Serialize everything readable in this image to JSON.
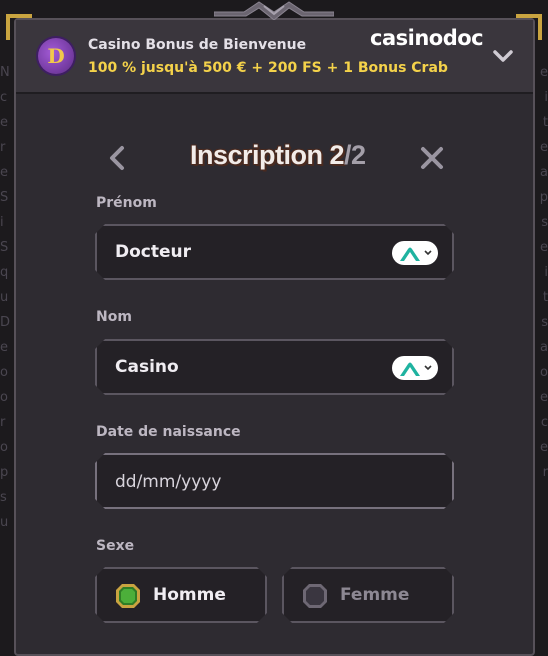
{
  "promo": {
    "title": "Casino Bonus de Bienvenue",
    "offer": "100 % jusqu'à 500 € + 200 FS + 1 Bonus Crab",
    "brand": "casinodoc",
    "logo_letter": "D"
  },
  "form": {
    "title_prefix": "Inscription 2",
    "title_suffix": "/2",
    "fields": {
      "first_name": {
        "label": "Prénom",
        "value": "Docteur"
      },
      "last_name": {
        "label": "Nom",
        "value": "Casino"
      },
      "birthdate": {
        "label": "Date de naissance",
        "placeholder": "dd/mm/yyyy"
      }
    },
    "gender": {
      "label": "Sexe",
      "options": [
        "Homme",
        "Femme"
      ],
      "selected": "Homme"
    }
  },
  "colors": {
    "accent_gold": "#c9a440",
    "offer_yellow": "#f4d24a",
    "selected_gem": "#4caf3a",
    "autofill_teal": "#1fb3a0"
  },
  "icons": {
    "prev": "chevron-left-icon",
    "close": "close-icon",
    "toggle": "chevron-down-icon",
    "autofill": "autofill-mountain-icon"
  }
}
